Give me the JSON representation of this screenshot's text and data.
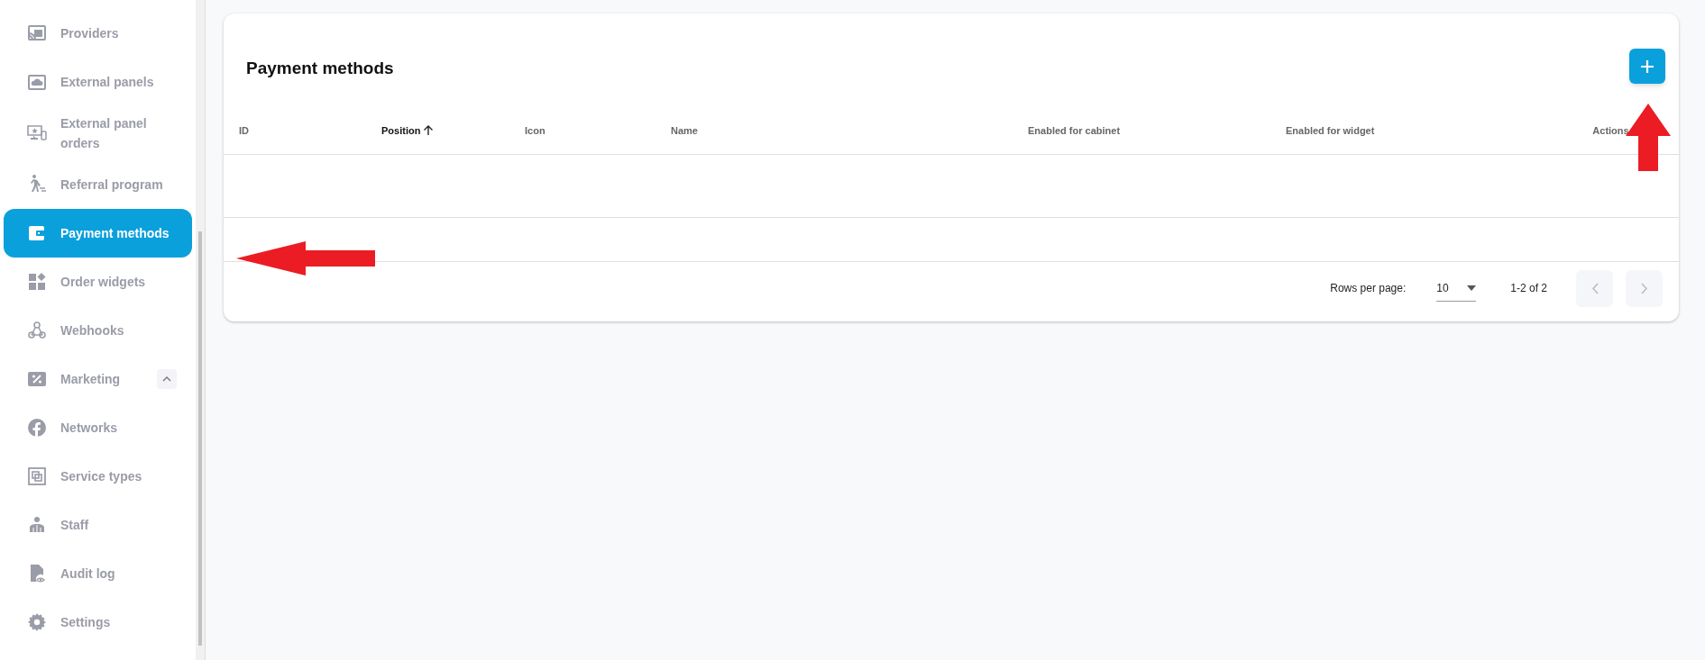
{
  "sidebar": {
    "items": [
      {
        "label": "Providers",
        "selected": false
      },
      {
        "label": "External panels",
        "selected": false
      },
      {
        "label": "External panel orders",
        "selected": false
      },
      {
        "label": "Referral program",
        "selected": false
      },
      {
        "label": "Payment methods",
        "selected": true
      },
      {
        "label": "Order widgets",
        "selected": false
      },
      {
        "label": "Webhooks",
        "selected": false
      },
      {
        "label": "Marketing",
        "selected": false,
        "expanded": true
      },
      {
        "label": "Networks",
        "selected": false
      },
      {
        "label": "Service types",
        "selected": false
      },
      {
        "label": "Staff",
        "selected": false
      },
      {
        "label": "Audit log",
        "selected": false
      },
      {
        "label": "Settings",
        "selected": false
      }
    ]
  },
  "card": {
    "title": "Payment methods",
    "table": {
      "columns": [
        {
          "label": "ID",
          "sorted": false
        },
        {
          "label": "Position",
          "sorted": true
        },
        {
          "label": "Icon",
          "sorted": false
        },
        {
          "label": "Name",
          "sorted": false
        },
        {
          "label": "Enabled for cabinet",
          "sorted": false
        },
        {
          "label": "Enabled for widget",
          "sorted": false
        },
        {
          "label": "Actions",
          "sorted": false
        }
      ]
    },
    "pagination": {
      "rows_per_page_label": "Rows per page:",
      "rows_per_page": "10",
      "range": "1-2 of 2"
    }
  }
}
